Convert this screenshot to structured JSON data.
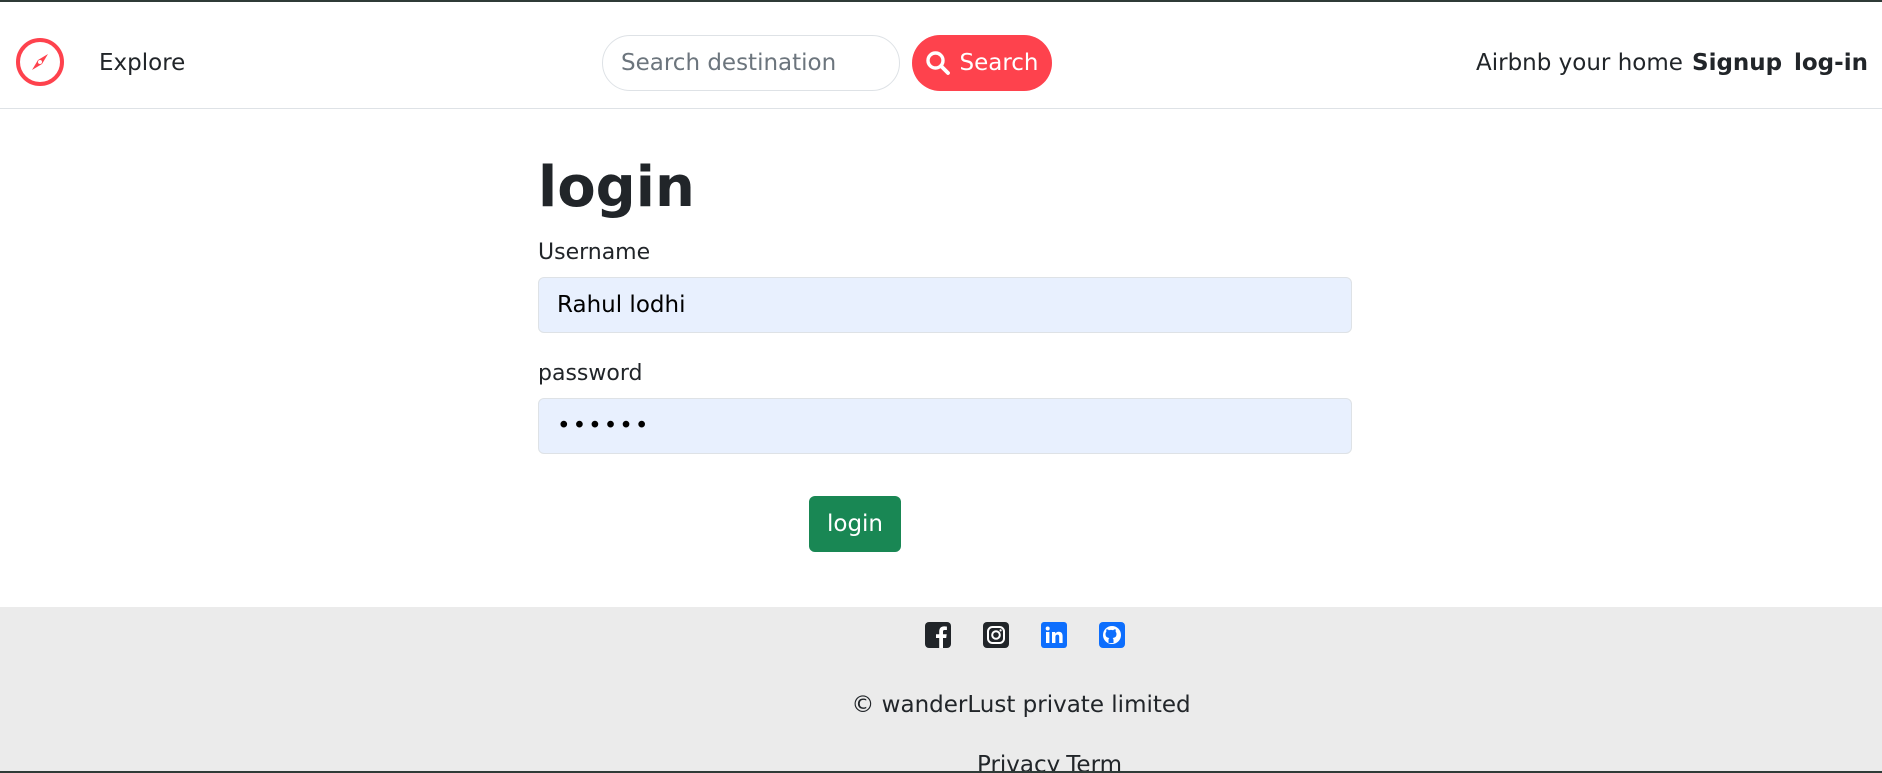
{
  "nav": {
    "brand_icon": "compass-icon",
    "brand_color": "#fe424d",
    "explore_label": "Explore",
    "search_placeholder": "Search destination",
    "search_button_label": "Search",
    "search_button_color": "#fe424d",
    "airbnb_label": "Airbnb your home",
    "signup_label": "Signup",
    "login_label": "log-in"
  },
  "form": {
    "title": "login",
    "username_label": "Username",
    "username_value": "Rahul lodhi",
    "password_label": "password",
    "password_value": "••••••",
    "submit_label": "login",
    "submit_color": "#198754"
  },
  "footer": {
    "social_icons": [
      "facebook-icon",
      "instagram-icon",
      "linkedin-icon",
      "github-icon"
    ],
    "copyright": "© wanderLust private limited",
    "links": [
      "Privacy",
      "Term"
    ]
  }
}
